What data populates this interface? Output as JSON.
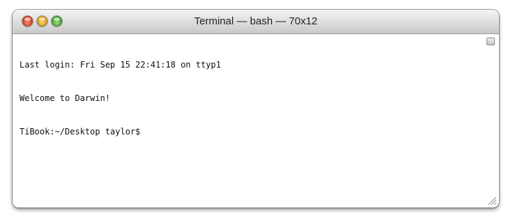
{
  "window": {
    "title": "Terminal — bash — 70x12"
  },
  "terminal": {
    "lines": [
      "Last login: Fri Sep 15 22:41:18 on ttyp1",
      "Welcome to Darwin!",
      "TiBook:~/Desktop taylor$"
    ]
  },
  "icons": {
    "close": "close-button",
    "minimize": "minimize-button",
    "zoom": "zoom-button",
    "toolbar_toggle": "toolbar-toggle-icon",
    "resize": "resize-grip-icon"
  },
  "colors": {
    "close": "#d1391c",
    "minimize": "#d59a13",
    "zoom": "#3a9c2a",
    "text": "#111111",
    "background": "#ffffff"
  }
}
